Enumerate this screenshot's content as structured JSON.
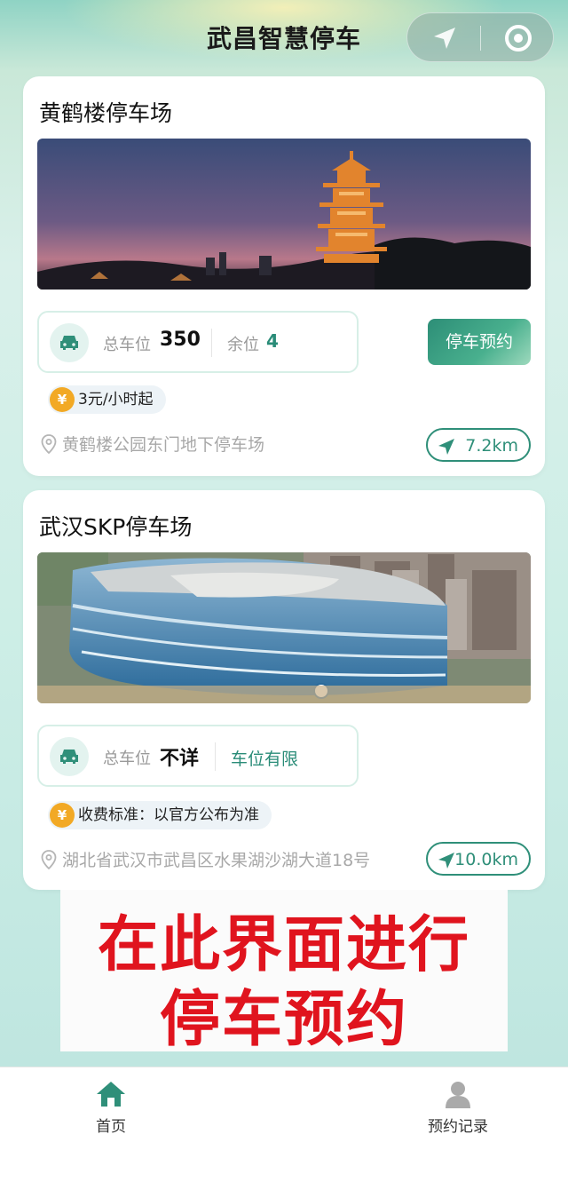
{
  "app": {
    "title": "武昌智慧停车"
  },
  "lots": [
    {
      "name": "黄鹤楼停车场",
      "total_label": "总车位",
      "total_value": "350",
      "remain_label": "余位",
      "remain_value": "4",
      "reserve_button": "停车预约",
      "price": "3元/小时起",
      "address": "黄鹤楼公园东门地下停车场",
      "distance": "7.2km"
    },
    {
      "name": "武汉SKP停车场",
      "total_label": "总车位",
      "total_value": "不详",
      "status": "车位有限",
      "price": "收费标准：以官方公布为准",
      "address": "湖北省武汉市武昌区水果湖沙湖大道18号",
      "distance": "10.0km"
    }
  ],
  "overlay": {
    "line1": "在此界面进行",
    "line2": "停车预约"
  },
  "tabbar": {
    "home": "首页",
    "records": "预约记录"
  },
  "colors": {
    "accent": "#2f8f79",
    "overlay_red": "#e0141e",
    "coin": "#f2a925"
  },
  "icons": [
    "location-arrow-icon",
    "target-icon",
    "car-icon",
    "coin-icon",
    "map-pin-icon",
    "navigation-icon",
    "home-icon",
    "user-icon"
  ]
}
